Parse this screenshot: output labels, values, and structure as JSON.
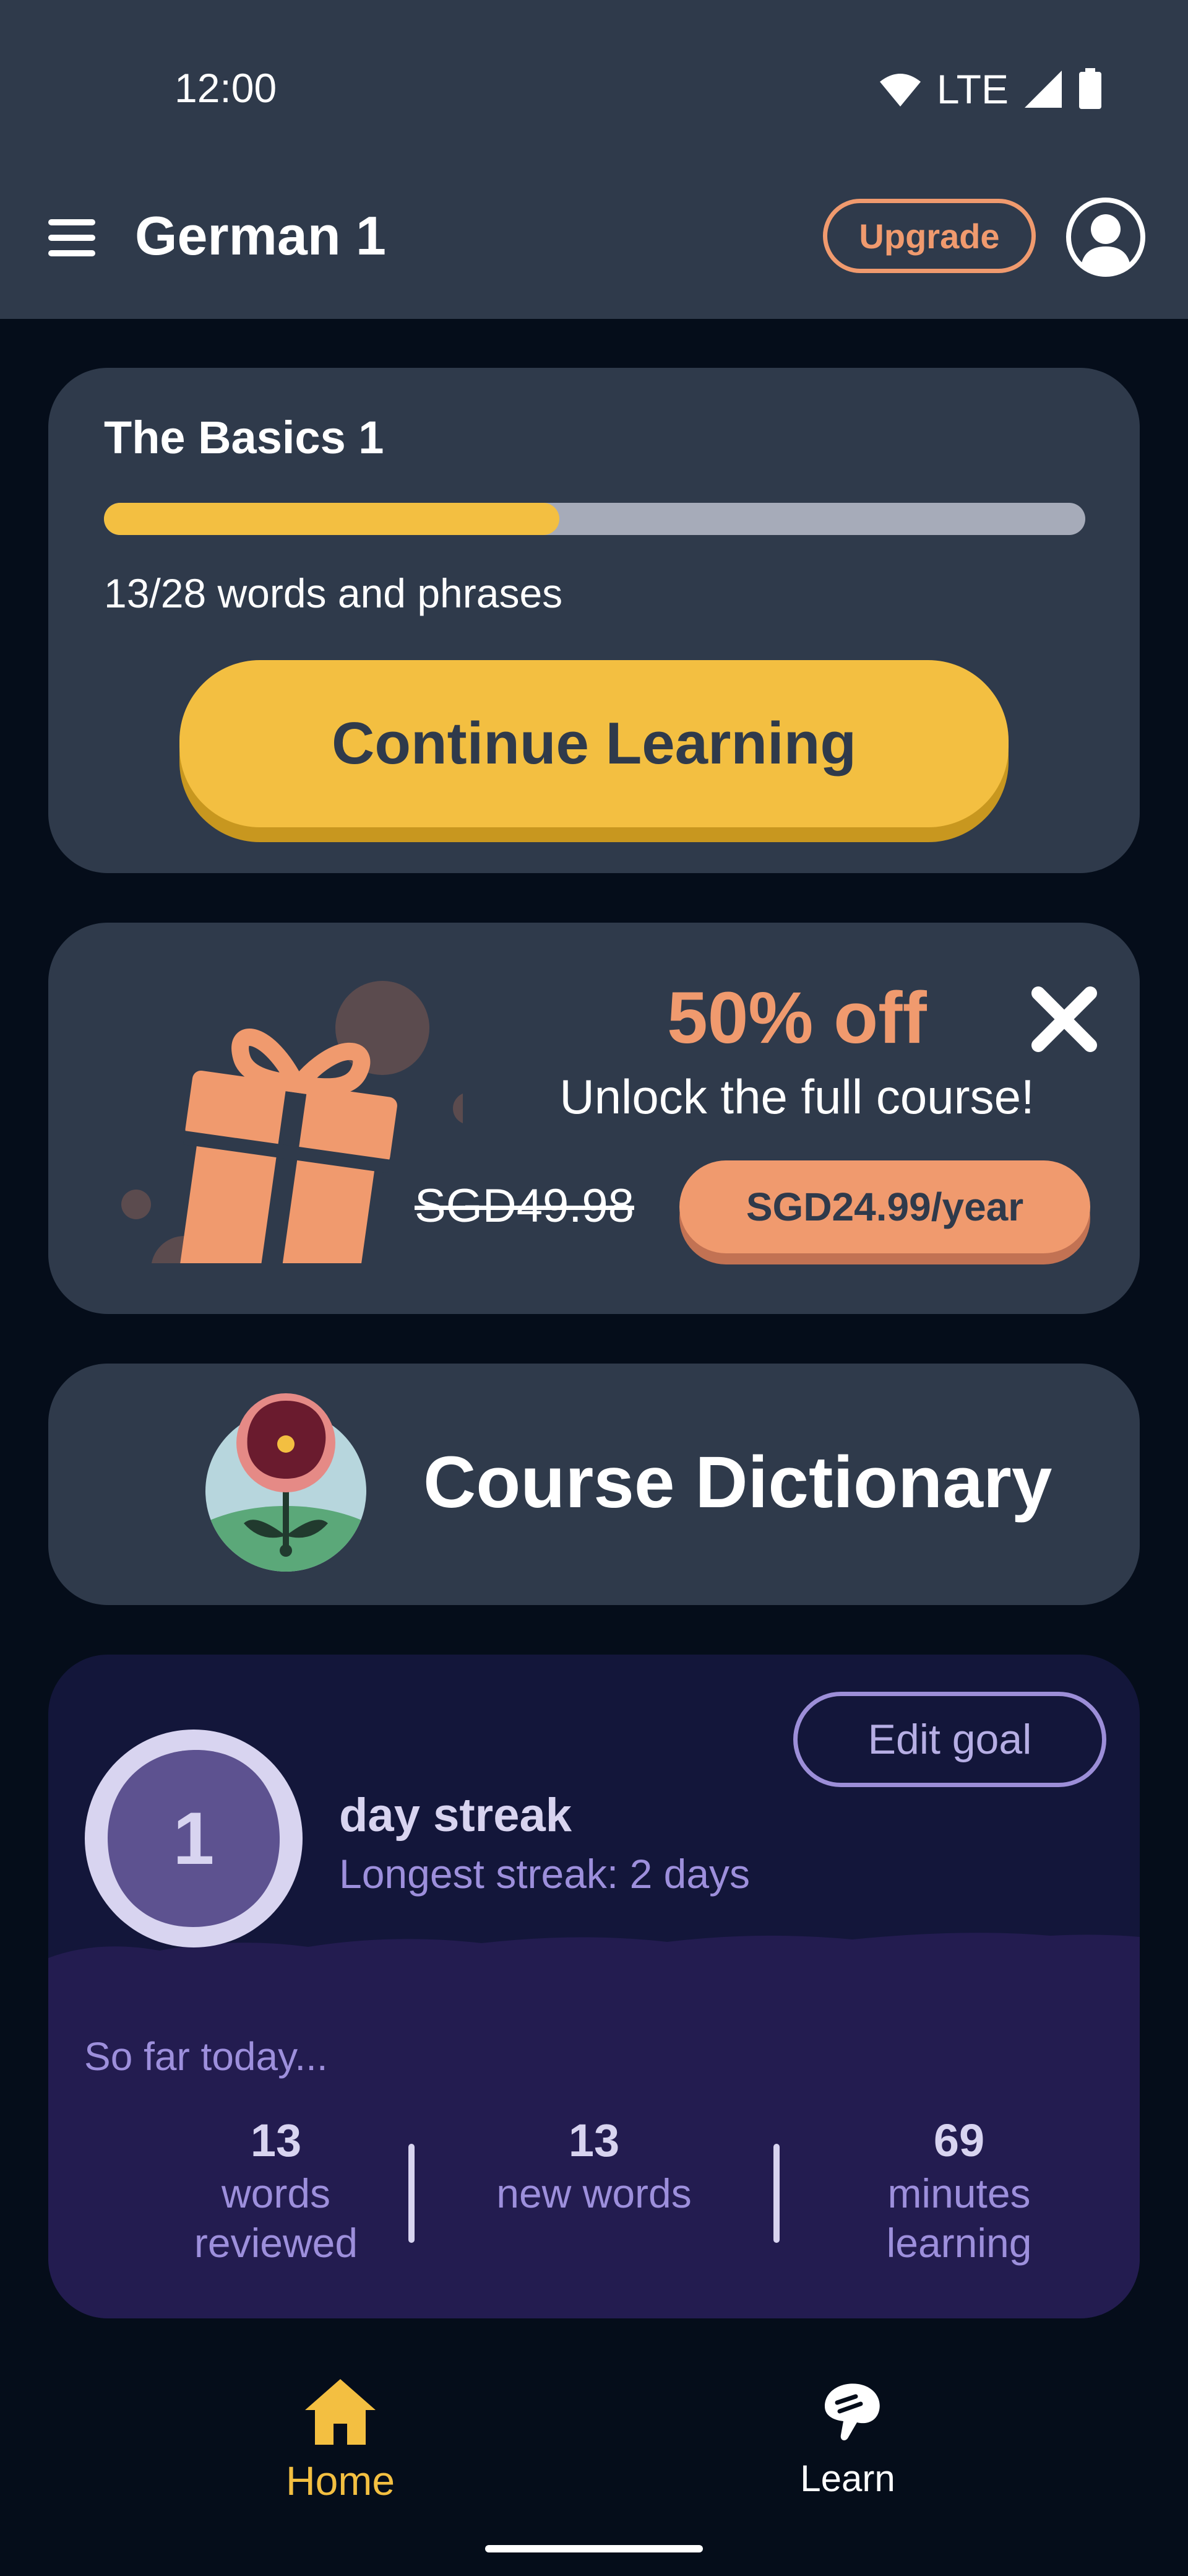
{
  "status_bar": {
    "time": "12:00",
    "network": "LTE"
  },
  "app_bar": {
    "title": "German 1",
    "upgrade_label": "Upgrade"
  },
  "basics_card": {
    "title": "The Basics 1",
    "progress": {
      "done": 13,
      "total": 28
    },
    "progress_text": "13/28 words and phrases",
    "continue_label": "Continue Learning"
  },
  "offer_card": {
    "headline": "50% off",
    "subtitle": "Unlock the full course!",
    "old_price": "SGD49.98",
    "price_label": "SGD24.99/year"
  },
  "dictionary_card": {
    "title": "Course Dictionary"
  },
  "streak_card": {
    "count": "1",
    "label": "day streak",
    "longest": "Longest streak: 2 days",
    "edit_goal_label": "Edit goal",
    "today_label": "So far today...",
    "stats": [
      {
        "value": "13",
        "line1": "words",
        "line2": "reviewed"
      },
      {
        "value": "13",
        "line1": "new words",
        "line2": ""
      },
      {
        "value": "69",
        "line1": "minutes",
        "line2": "learning"
      }
    ]
  },
  "bottom_nav": {
    "items": [
      {
        "label": "Home",
        "icon": "home-icon",
        "active": true
      },
      {
        "label": "Learn",
        "icon": "learn-icon",
        "active": false
      }
    ]
  },
  "colors": {
    "accent_yellow": "#f3bf41",
    "accent_orange": "#f09a6e",
    "card_bg": "#2f3a4b",
    "page_bg": "#050d1a",
    "streak_bg": "#13163a",
    "streak_lower_bg": "#231c50",
    "streak_text": "#9d8fdc"
  }
}
